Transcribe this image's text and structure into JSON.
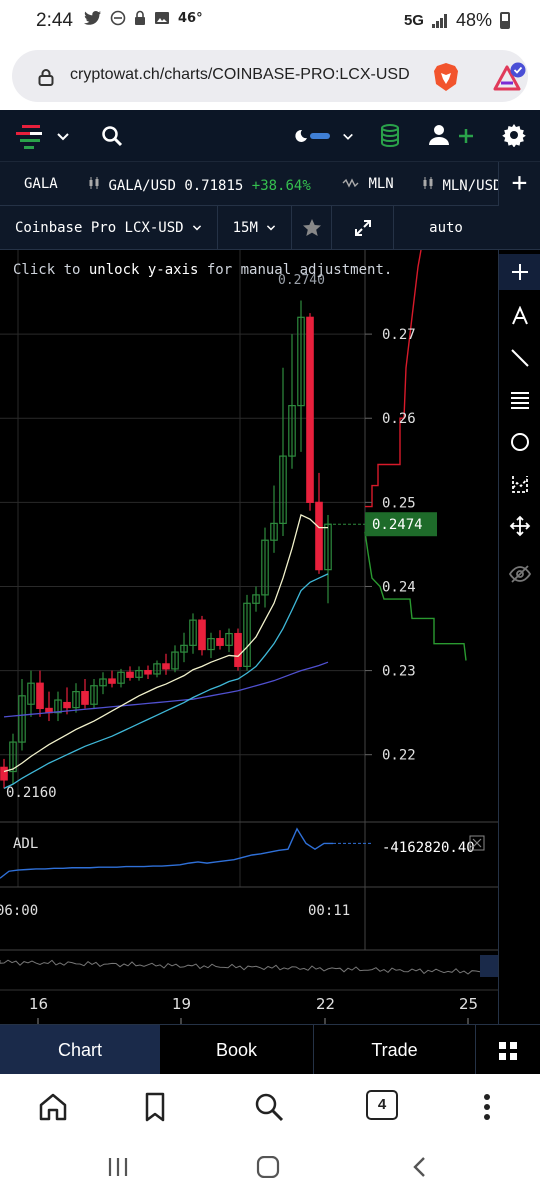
{
  "status": {
    "time": "2:44",
    "temp": "46°",
    "network": "5G",
    "battery": "48%"
  },
  "browser": {
    "url": "cryptowat.ch/charts/COINBASE-PRO:LCX-USD",
    "tab_count": "4"
  },
  "ticker": {
    "items": [
      {
        "label": "GALA"
      },
      {
        "label": "GALA/USD",
        "price": "0.71815",
        "change": "+38.64%"
      },
      {
        "label": "MLN"
      },
      {
        "label": "MLN/USD"
      }
    ],
    "add_label": "+"
  },
  "controls": {
    "market": "Coinbase Pro LCX-USD",
    "interval": "15M",
    "scale": "auto"
  },
  "chart": {
    "hint_prefix": "Click to ",
    "hint_bold": "unlock y-axis",
    "hint_suffix": " for manual adjustment.",
    "indicator": "ADL",
    "adl_value": "-4162820.40",
    "price_tag": "0.2474",
    "low_label": "0.2160",
    "high_label": "0.2740",
    "colors": {
      "up": "#2e8b3e",
      "down": "#e8203c",
      "ema_fast": "#f2f2cc",
      "ema_mid": "#3fb8d8",
      "ema_slow": "#5050d0",
      "adl": "#2f70d8",
      "tag_bg": "#1e6b2a",
      "ask": "#d81a2a",
      "bid": "#2a9a30"
    }
  },
  "chart_data": {
    "type": "candlestick",
    "ylim": [
      0.212,
      0.28
    ],
    "y_ticks": [
      "0.27",
      "0.26",
      "0.25",
      "0.2474",
      "0.24",
      "0.23",
      "0.22"
    ],
    "x_time_ticks": [
      "06:00",
      "00:11"
    ],
    "x_range_ticks": [
      "16",
      "19",
      "22",
      "25"
    ],
    "candles": [
      {
        "o": 0.2185,
        "h": 0.2195,
        "l": 0.216,
        "c": 0.217
      },
      {
        "o": 0.218,
        "h": 0.2225,
        "l": 0.2165,
        "c": 0.2215
      },
      {
        "o": 0.2215,
        "h": 0.229,
        "l": 0.2205,
        "c": 0.227
      },
      {
        "o": 0.226,
        "h": 0.23,
        "l": 0.2245,
        "c": 0.2285
      },
      {
        "o": 0.2285,
        "h": 0.23,
        "l": 0.2245,
        "c": 0.2255
      },
      {
        "o": 0.2255,
        "h": 0.2275,
        "l": 0.224,
        "c": 0.225
      },
      {
        "o": 0.225,
        "h": 0.2275,
        "l": 0.224,
        "c": 0.2265
      },
      {
        "o": 0.2262,
        "h": 0.228,
        "l": 0.2248,
        "c": 0.2256
      },
      {
        "o": 0.2256,
        "h": 0.2285,
        "l": 0.225,
        "c": 0.2275
      },
      {
        "o": 0.2275,
        "h": 0.229,
        "l": 0.2255,
        "c": 0.226
      },
      {
        "o": 0.226,
        "h": 0.229,
        "l": 0.2255,
        "c": 0.2282
      },
      {
        "o": 0.2282,
        "h": 0.2298,
        "l": 0.2272,
        "c": 0.229
      },
      {
        "o": 0.229,
        "h": 0.23,
        "l": 0.228,
        "c": 0.2285
      },
      {
        "o": 0.2285,
        "h": 0.2302,
        "l": 0.228,
        "c": 0.2298
      },
      {
        "o": 0.2298,
        "h": 0.2305,
        "l": 0.2288,
        "c": 0.2292
      },
      {
        "o": 0.2292,
        "h": 0.2305,
        "l": 0.2288,
        "c": 0.23
      },
      {
        "o": 0.23,
        "h": 0.2306,
        "l": 0.229,
        "c": 0.2296
      },
      {
        "o": 0.2296,
        "h": 0.2312,
        "l": 0.2292,
        "c": 0.2308
      },
      {
        "o": 0.2308,
        "h": 0.232,
        "l": 0.2295,
        "c": 0.2302
      },
      {
        "o": 0.2302,
        "h": 0.233,
        "l": 0.2298,
        "c": 0.2322
      },
      {
        "o": 0.2322,
        "h": 0.2345,
        "l": 0.231,
        "c": 0.233
      },
      {
        "o": 0.233,
        "h": 0.2368,
        "l": 0.232,
        "c": 0.236
      },
      {
        "o": 0.236,
        "h": 0.2365,
        "l": 0.2318,
        "c": 0.2325
      },
      {
        "o": 0.2325,
        "h": 0.2345,
        "l": 0.2315,
        "c": 0.2338
      },
      {
        "o": 0.2338,
        "h": 0.2348,
        "l": 0.2325,
        "c": 0.233
      },
      {
        "o": 0.233,
        "h": 0.235,
        "l": 0.2322,
        "c": 0.2344
      },
      {
        "o": 0.2344,
        "h": 0.235,
        "l": 0.23,
        "c": 0.2305
      },
      {
        "o": 0.2305,
        "h": 0.239,
        "l": 0.23,
        "c": 0.238
      },
      {
        "o": 0.238,
        "h": 0.24,
        "l": 0.237,
        "c": 0.239
      },
      {
        "o": 0.239,
        "h": 0.247,
        "l": 0.2375,
        "c": 0.2455
      },
      {
        "o": 0.2455,
        "h": 0.252,
        "l": 0.244,
        "c": 0.2475
      },
      {
        "o": 0.2475,
        "h": 0.266,
        "l": 0.246,
        "c": 0.2555
      },
      {
        "o": 0.2555,
        "h": 0.27,
        "l": 0.254,
        "c": 0.2615
      },
      {
        "o": 0.2615,
        "h": 0.274,
        "l": 0.256,
        "c": 0.272
      },
      {
        "o": 0.272,
        "h": 0.2725,
        "l": 0.249,
        "c": 0.25
      },
      {
        "o": 0.25,
        "h": 0.2535,
        "l": 0.2415,
        "c": 0.242
      },
      {
        "o": 0.242,
        "h": 0.2485,
        "l": 0.238,
        "c": 0.2474
      }
    ],
    "ema_fast": [
      0.218,
      0.2183,
      0.219,
      0.2198,
      0.2205,
      0.2212,
      0.2218,
      0.2224,
      0.223,
      0.2235,
      0.224,
      0.2246,
      0.2252,
      0.2258,
      0.2264,
      0.227,
      0.2275,
      0.228,
      0.2284,
      0.2289,
      0.2294,
      0.2301,
      0.2305,
      0.231,
      0.2314,
      0.2318,
      0.2317,
      0.2328,
      0.234,
      0.236,
      0.238,
      0.241,
      0.2445,
      0.2485,
      0.248,
      0.247,
      0.247
    ],
    "ema_mid": [
      0.216,
      0.2165,
      0.2172,
      0.2178,
      0.2184,
      0.219,
      0.2195,
      0.22,
      0.2205,
      0.221,
      0.2214,
      0.2218,
      0.2222,
      0.2227,
      0.2232,
      0.2237,
      0.2242,
      0.2247,
      0.2252,
      0.2257,
      0.2262,
      0.2268,
      0.2273,
      0.2278,
      0.2282,
      0.2287,
      0.229,
      0.2297,
      0.2305,
      0.2318,
      0.2332,
      0.235,
      0.2372,
      0.2395,
      0.2405,
      0.241,
      0.2415
    ],
    "ema_slow": [
      0.2245,
      0.2246,
      0.2247,
      0.2248,
      0.2249,
      0.225,
      0.2251,
      0.2252,
      0.2253,
      0.2254,
      0.2255,
      0.2256,
      0.2257,
      0.2258,
      0.2259,
      0.226,
      0.2261,
      0.2262,
      0.2263,
      0.2264,
      0.2265,
      0.2266,
      0.2268,
      0.227,
      0.2272,
      0.2274,
      0.2276,
      0.2279,
      0.2282,
      0.2285,
      0.2288,
      0.2292,
      0.2296,
      0.23,
      0.2303,
      0.2306,
      0.231
    ],
    "adl": [
      0.1,
      0.22,
      0.24,
      0.25,
      0.26,
      0.26,
      0.27,
      0.27,
      0.28,
      0.28,
      0.28,
      0.29,
      0.29,
      0.29,
      0.3,
      0.3,
      0.3,
      0.31,
      0.31,
      0.32,
      0.33,
      0.36,
      0.38,
      0.36,
      0.38,
      0.4,
      0.42,
      0.46,
      0.5,
      0.52,
      0.55,
      0.58,
      0.6,
      0.95,
      0.7,
      0.6,
      0.7,
      0.7
    ]
  }
}
